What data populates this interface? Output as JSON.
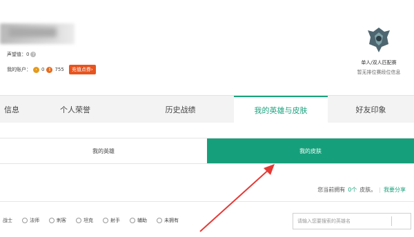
{
  "profile": {
    "reputation_label": "声望值：0",
    "account_label": "我的账户：",
    "gold_amount": "0",
    "coupon_amount": "755",
    "recharge_label": "充值点券›"
  },
  "rank": {
    "title": "单人/双人匹配赛",
    "subtitle": "暂无排位赛段位信息"
  },
  "tabs": [
    {
      "label": "信息"
    },
    {
      "label": "个人荣誉"
    },
    {
      "label": "历史战绩"
    },
    {
      "label": "我的英雄与皮肤"
    },
    {
      "label": "好友印象"
    }
  ],
  "subtabs": [
    {
      "label": "我的英雄"
    },
    {
      "label": "我的皮肤"
    }
  ],
  "count_row": {
    "prefix": "您当前拥有",
    "count": "0个",
    "suffix": "皮肤。",
    "separator": "|",
    "share_label": "我要分享"
  },
  "filters": [
    {
      "label": "战士"
    },
    {
      "label": "法师"
    },
    {
      "label": "刺客"
    },
    {
      "label": "坦克"
    },
    {
      "label": "射手"
    },
    {
      "label": "辅助"
    },
    {
      "label": "未拥有"
    }
  ],
  "search": {
    "placeholder": "请输入您要搜索的英雄名"
  },
  "colors": {
    "accent": "#169f7b",
    "recharge": "#e8541e",
    "annotation_arrow": "#e53935"
  }
}
